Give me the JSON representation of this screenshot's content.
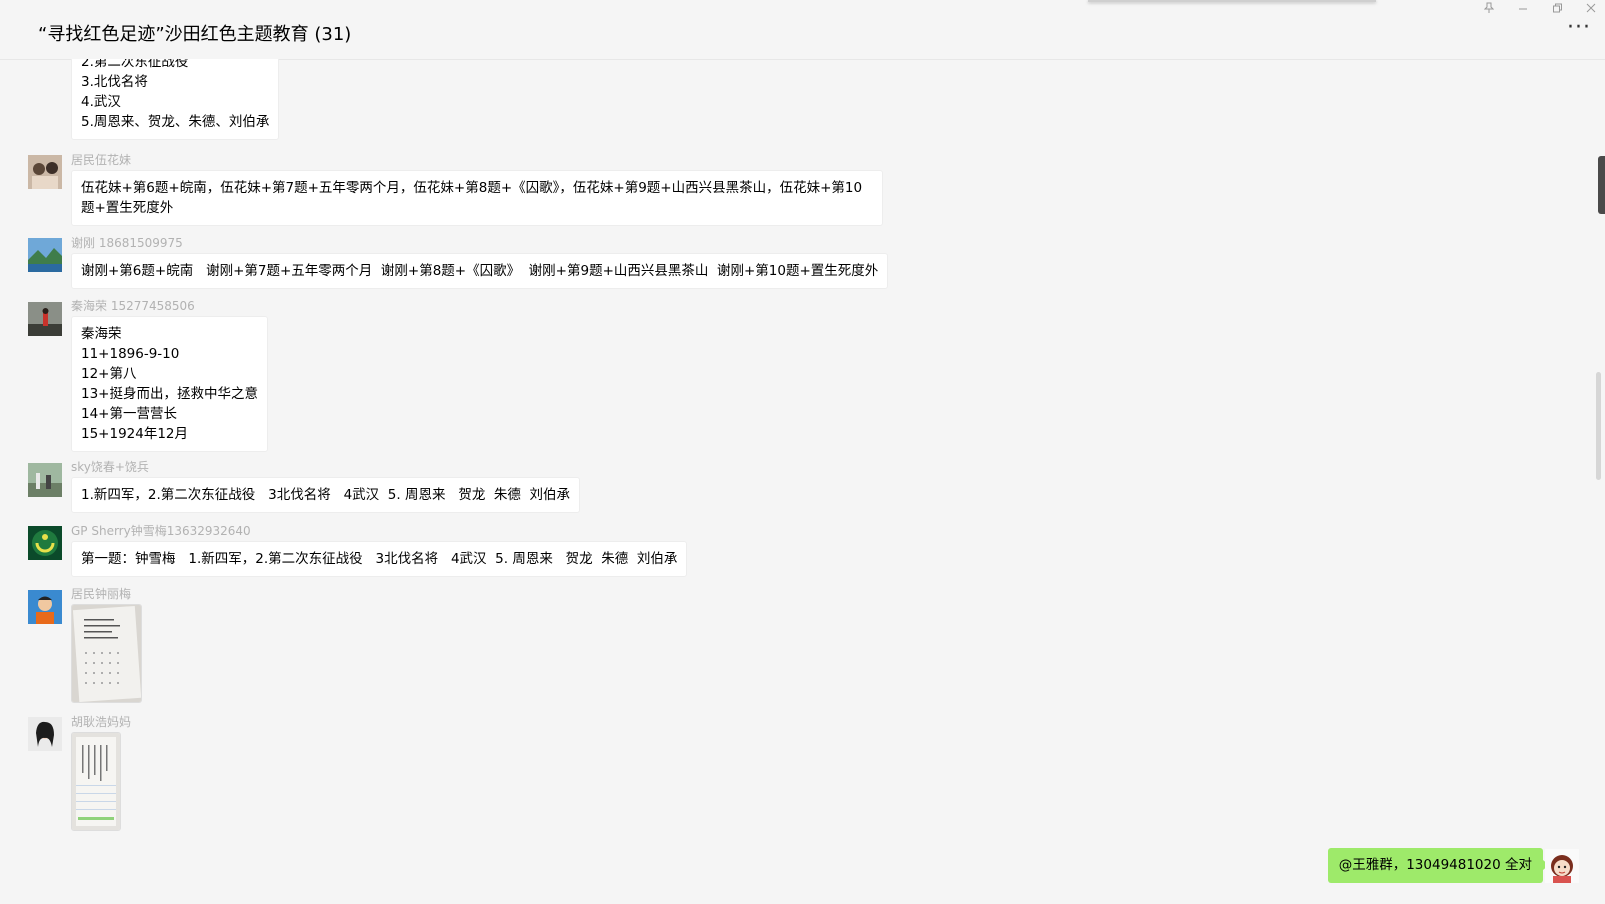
{
  "window": {
    "title": "“寻找红色足迹”沙田红色主题教育 (31)",
    "controls": [
      "pin-icon",
      "minimize-icon",
      "restore-icon",
      "close-icon"
    ],
    "more_label": "···"
  },
  "messages": [
    {
      "sender": "",
      "text": "2.第二次东征战役\n3.北伐名将\n4.武汉\n5.周恩来、贺龙、朱德、刘伯承"
    },
    {
      "sender": "居民伍花妹",
      "text": "伍花妹+第6题+皖南，伍花妹+第7题+五年零两个月，伍花妹+第8题+《囚歌》，伍花妹+第9题+山西兴县黑茶山，伍花妹+第10题+置生死度外"
    },
    {
      "sender": "谢刚 18681509975",
      "text": "谢刚+第6题+皖南   谢刚+第7题+五年零两个月  谢刚+第8题+《囚歌》  谢刚+第9题+山西兴县黑茶山  谢刚+第10题+置生死度外"
    },
    {
      "sender": "秦海荣 15277458506",
      "text": "秦海荣\n11+1896-9-10\n12+第八\n13+挺身而出，拯救中华之意\n14+第一营营长\n15+1924年12月"
    },
    {
      "sender": "sky饶春+饶兵",
      "text": "1.新四军，2.第二次东征战役   3北伐名将   4武汉  5. 周恩来   贺龙  朱德  刘伯承"
    },
    {
      "sender": "GP   Sherry钟雪梅13632932640",
      "text": "第一题：钟雪梅   1.新四军，2.第二次东征战役   3北伐名将   4武汉  5. 周恩来   贺龙  朱德  刘伯承"
    },
    {
      "sender": "居民钟丽梅",
      "image": "handwritten-answer-photo"
    },
    {
      "sender": "胡耿浩妈妈",
      "image": "handwritten-notebook-photo"
    }
  ],
  "sent": {
    "text": "@王雅群，13049481020 全对"
  }
}
